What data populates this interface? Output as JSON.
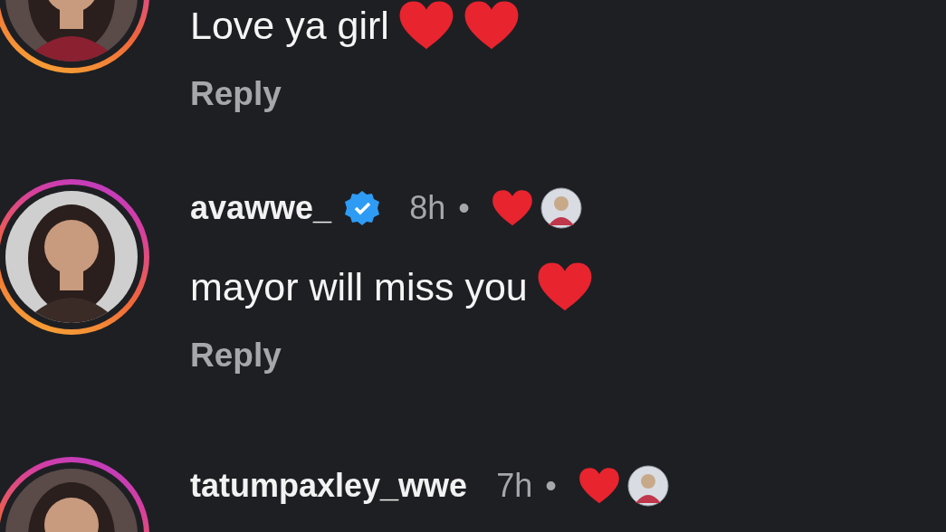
{
  "comments": [
    {
      "avatar": {
        "kind": "picture"
      },
      "text": "Love ya girl",
      "emojis": [
        {
          "kind": "heart"
        },
        {
          "kind": "heart"
        }
      ],
      "reply": "Reply"
    },
    {
      "avatar": {
        "kind": "picture"
      },
      "username": "avawwe_",
      "verified": true,
      "time": "8h",
      "separator": "•",
      "liked_by_author": true,
      "text": "mayor will miss you",
      "emojis": [
        {
          "kind": "heart"
        }
      ],
      "reply": "Reply"
    },
    {
      "avatar": {
        "kind": "picture"
      },
      "username": "tatumpaxley_wwe",
      "verified": false,
      "time": "7h",
      "separator": "•",
      "liked_by_author": true
    }
  ]
}
